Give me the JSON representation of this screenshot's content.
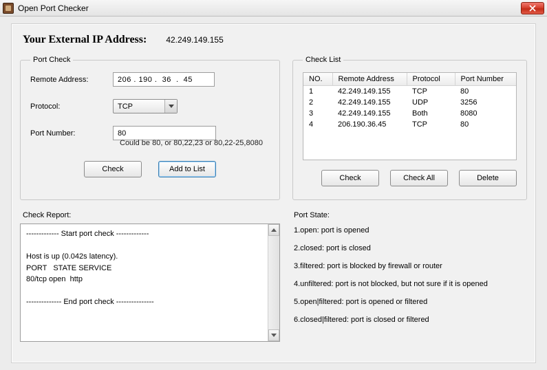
{
  "window": {
    "title": "Open Port Checker"
  },
  "header": {
    "ip_label": "Your External IP Address:",
    "ip_value": "42.249.149.155"
  },
  "port_check": {
    "legend": "Port Check",
    "remote_address_label": "Remote Address:",
    "remote_address_value": "206 . 190 .  36  .  45",
    "protocol_label": "Protocol:",
    "protocol_value": "TCP",
    "port_label": "Port Number:",
    "port_value": "80",
    "hint": "Could be 80, or 80,22,23 or 80,22-25,8080",
    "check_btn": "Check",
    "add_btn": "Add to List"
  },
  "check_list": {
    "legend": "Check List",
    "columns": {
      "no": "NO.",
      "remote": "Remote Address",
      "protocol": "Protocol",
      "port": "Port Number"
    },
    "rows": [
      {
        "no": "1",
        "remote": "42.249.149.155",
        "protocol": "TCP",
        "port": "80"
      },
      {
        "no": "2",
        "remote": "42.249.149.155",
        "protocol": "UDP",
        "port": "3256"
      },
      {
        "no": "3",
        "remote": "42.249.149.155",
        "protocol": "Both",
        "port": "8080"
      },
      {
        "no": "4",
        "remote": "206.190.36.45",
        "protocol": "TCP",
        "port": "80"
      }
    ],
    "check_btn": "Check",
    "check_all_btn": "Check All",
    "delete_btn": "Delete"
  },
  "check_report": {
    "label": "Check Report:",
    "text": "------------- Start port check -------------\n\nHost is up (0.042s latency).\nPORT   STATE SERVICE\n80/tcp open  http\n\n-------------- End port check ---------------"
  },
  "port_state": {
    "header": "Port State:",
    "lines": [
      "1.open: port is opened",
      "2.closed: port is closed",
      "3.filtered: port is blocked by firewall or router",
      "4.unfiltered: port is not blocked, but not sure if it is opened",
      "5.open|filtered: port is opened or filtered",
      "6.closed|filtered: port is closed or filtered"
    ]
  }
}
